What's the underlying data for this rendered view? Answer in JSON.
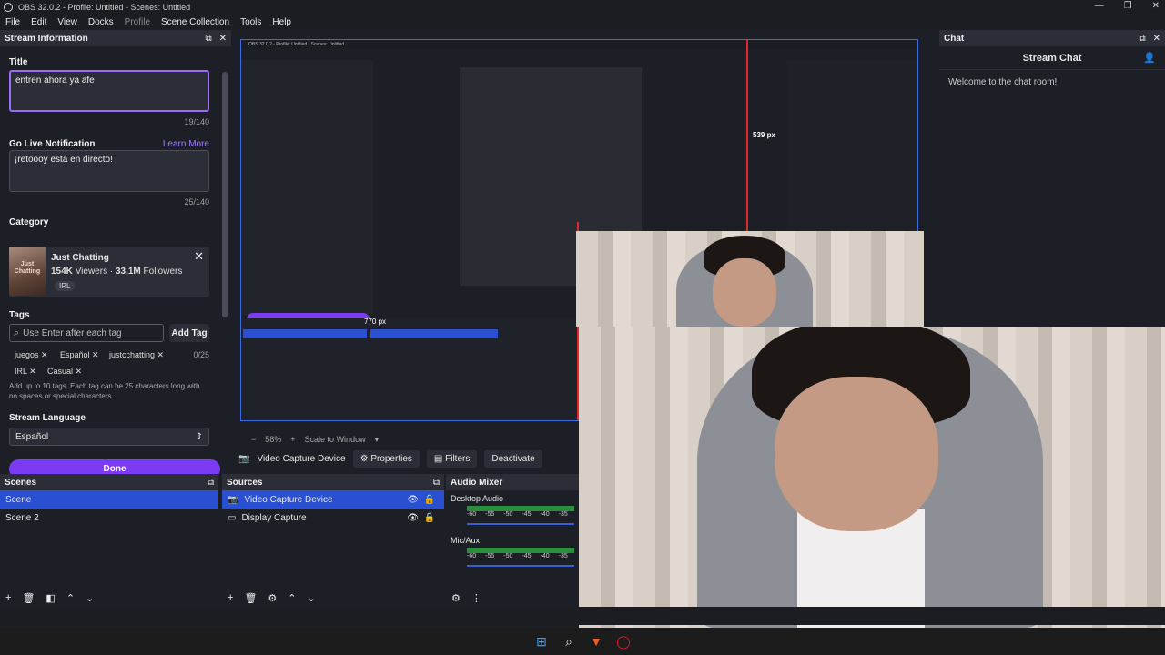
{
  "window": {
    "title": "OBS 32.0.2 - Profile: Untitled - Scenes: Untitled"
  },
  "menu": [
    "File",
    "Edit",
    "View",
    "Docks",
    "Profile",
    "Scene Collection",
    "Tools",
    "Help"
  ],
  "stream_info": {
    "header": "Stream Information",
    "title_label": "Title",
    "title_value": "entren ahora ya afe",
    "title_count": "19/140",
    "notif_label": "Go Live Notification",
    "learn_more": "Learn More",
    "notif_value": "¡retoooy está en directo!",
    "notif_count": "25/140",
    "category_label": "Category",
    "category": {
      "name": "Just Chatting",
      "viewers_num": "154K",
      "viewers_word": "Viewers",
      "followers_num": "33.1M",
      "followers_word": "Followers",
      "tag": "IRL",
      "image_text": "Just Chatting"
    },
    "tags_label": "Tags",
    "tag_placeholder": "Use Enter after each tag",
    "add_tag": "Add Tag",
    "tags": [
      "juegos",
      "Español",
      "justcchatting",
      "IRL",
      "Casual"
    ],
    "tag_count": "0/25",
    "tag_note": "Add up to 10 tags. Each tag can be 25 characters long with no spaces or special characters.",
    "language_label": "Stream Language",
    "language_value": "Español",
    "done": "Done"
  },
  "preview": {
    "zoom": "58%",
    "scale_mode": "Scale to Window",
    "source_name": "Video Capture Device",
    "properties": "Properties",
    "filters": "Filters",
    "deactivate": "Deactivate",
    "nested_title": "OBS 32.0.2 - Profile: Untitled - Scenes: Untitled",
    "nested_labels": {
      "px539": "539 px",
      "px770": "770 px"
    }
  },
  "scenes": {
    "header": "Scenes",
    "items": [
      "Scene",
      "Scene 2"
    ]
  },
  "sources": {
    "header": "Sources",
    "items": [
      "Video Capture Device",
      "Display Capture"
    ]
  },
  "audio": {
    "header": "Audio Mixer",
    "channels": [
      {
        "name": "Desktop Audio",
        "ticks": [
          "-60",
          "-55",
          "-50",
          "-45",
          "-40",
          "-35"
        ]
      },
      {
        "name": "Mic/Aux",
        "ticks": [
          "-60",
          "-55",
          "-50",
          "-45",
          "-40",
          "-35"
        ]
      }
    ]
  },
  "chat": {
    "dock_header": "Chat",
    "title": "Stream Chat",
    "welcome": "Welcome to the chat room!"
  },
  "colors": {
    "accent": "#7b3bf3",
    "selection": "#2a4fd1",
    "guide": "#e0282f"
  }
}
